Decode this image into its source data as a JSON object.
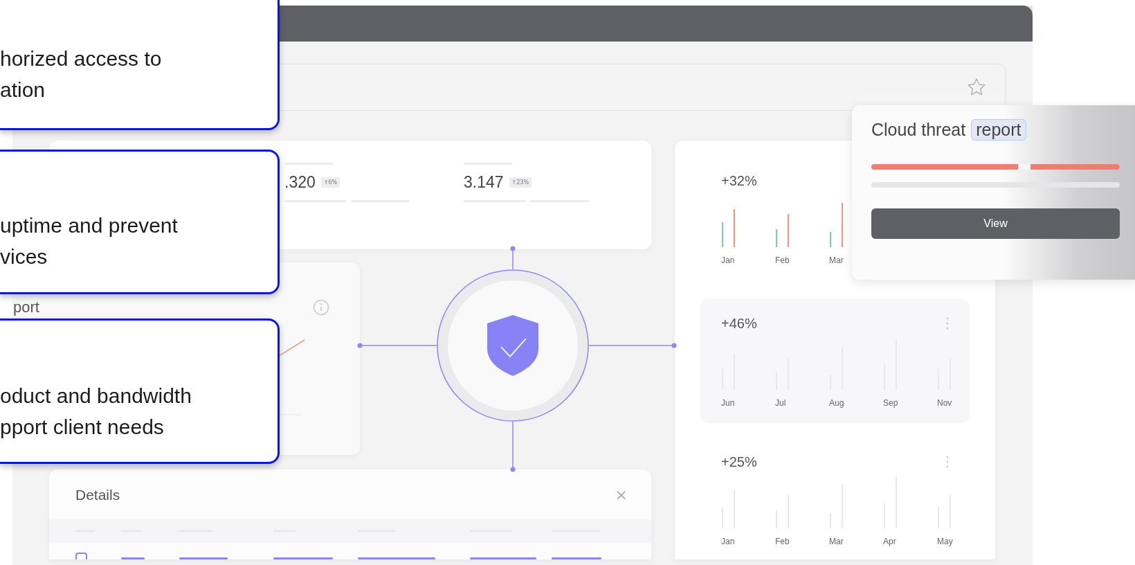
{
  "callouts": [
    {
      "lines": [
        "horized access to",
        "ation"
      ]
    },
    {
      "lines": [
        "uptime and prevent",
        "vices"
      ]
    },
    {
      "lines": [
        "oduct and bandwidth",
        "pport client needs"
      ]
    }
  ],
  "stats": [
    {
      "value": ".320",
      "change": "↑6%"
    },
    {
      "value": "3.147",
      "change": "↑23%"
    }
  ],
  "side_card": {
    "title": "port"
  },
  "details": {
    "title": "Details",
    "close": "×",
    "rows": [
      {
        "checked": false
      }
    ]
  },
  "charts": [
    {
      "kind": "colored",
      "change": "+32%",
      "months": [
        "Jan",
        "Feb",
        "Mar"
      ]
    },
    {
      "kind": "highlighted",
      "change": "+46%",
      "months": [
        "Jun",
        "Jul",
        "Aug",
        "Sep",
        "Nov"
      ]
    },
    {
      "kind": "plain",
      "change": "+25%",
      "months": [
        "Jan",
        "Feb",
        "Mar",
        "Apr",
        "May"
      ]
    }
  ],
  "popup": {
    "title": "Cloud threat",
    "tag": "report",
    "button": "View",
    "progress": {
      "level": 1
    }
  }
}
